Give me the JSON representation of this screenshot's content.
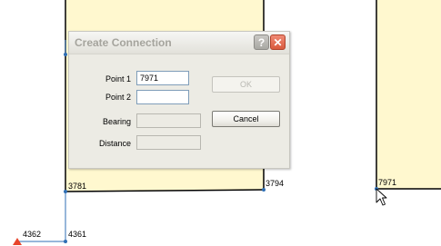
{
  "dialog": {
    "title": "Create Connection",
    "help_glyph": "?",
    "close_glyph": "✕",
    "fields": {
      "point1": {
        "label": "Point 1",
        "value": "7971"
      },
      "point2": {
        "label": "Point 2",
        "value": ""
      },
      "bearing": {
        "label": "Bearing",
        "value": ""
      },
      "distance": {
        "label": "Distance",
        "value": ""
      }
    },
    "buttons": {
      "ok": "OK",
      "cancel": "Cancel"
    }
  },
  "map": {
    "parcel_fill": "#fff8cf",
    "line_color": "#000000",
    "point_color": "#2f6fb5",
    "marker_color": "#e8452c",
    "point_labels": {
      "p3781": "3781",
      "p3794": "3794",
      "p7971": "7971",
      "p4362": "4362",
      "p4361": "4361"
    }
  },
  "icons": {
    "cursor": "mouse-pointer-icon",
    "help": "help-icon",
    "close": "close-icon",
    "marker": "red-marker-icon"
  }
}
